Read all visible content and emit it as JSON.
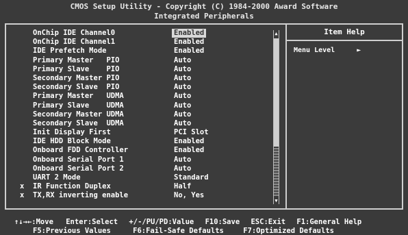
{
  "header": {
    "title_line1": "CMOS Setup Utility - Copyright (C) 1984-2000 Award Software",
    "title_line2": "Integrated Peripherals"
  },
  "settings": [
    {
      "mark": "",
      "label": "OnChip IDE Channel0",
      "value": "Enabled",
      "selected": true
    },
    {
      "mark": "",
      "label": "OnChip IDE Channel1",
      "value": "Enabled"
    },
    {
      "mark": "",
      "label": "IDE Prefetch Mode",
      "value": "Enabled"
    },
    {
      "mark": "",
      "label": "Primary Master   PIO",
      "value": "Auto"
    },
    {
      "mark": "",
      "label": "Primary Slave    PIO",
      "value": "Auto"
    },
    {
      "mark": "",
      "label": "Secondary Master PIO",
      "value": "Auto"
    },
    {
      "mark": "",
      "label": "Secondary Slave  PIO",
      "value": "Auto"
    },
    {
      "mark": "",
      "label": "Primary Master   UDMA",
      "value": "Auto"
    },
    {
      "mark": "",
      "label": "Primary Slave    UDMA",
      "value": "Auto"
    },
    {
      "mark": "",
      "label": "Secondary Master UDMA",
      "value": "Auto"
    },
    {
      "mark": "",
      "label": "Secondary Slave  UDMA",
      "value": "Auto"
    },
    {
      "mark": "",
      "label": "Init Display First",
      "value": "PCI Slot"
    },
    {
      "mark": "",
      "label": "IDE HDD Block Mode",
      "value": "Enabled"
    },
    {
      "mark": "",
      "label": "Onboard FDD Controller",
      "value": "Enabled"
    },
    {
      "mark": "",
      "label": "Onboard Serial Port 1",
      "value": "Auto"
    },
    {
      "mark": "",
      "label": "Onboard Serial Port 2",
      "value": "Auto"
    },
    {
      "mark": "",
      "label": "UART 2 Mode",
      "value": "Standard"
    },
    {
      "mark": "x",
      "label": "IR Function Duplex",
      "value": "Half"
    },
    {
      "mark": "x",
      "label": "TX,RX inverting enable",
      "value": "No, Yes"
    }
  ],
  "help": {
    "title": "Item Help",
    "menu_level_label": "Menu Level",
    "menu_level_arrow": "►"
  },
  "scrollbar": {
    "up_arrow": "▲",
    "down_arrow": "▼"
  },
  "footer": {
    "move": "↑↓→←:Move",
    "select": "Enter:Select",
    "value": "+/-/PU/PD:Value",
    "save": "F10:Save",
    "exit": "ESC:Exit",
    "help": "F1:General Help",
    "previous": "F5:Previous Values",
    "failsafe": "F6:Fail-Safe Defaults",
    "optimized": "F7:Optimized Defaults"
  }
}
